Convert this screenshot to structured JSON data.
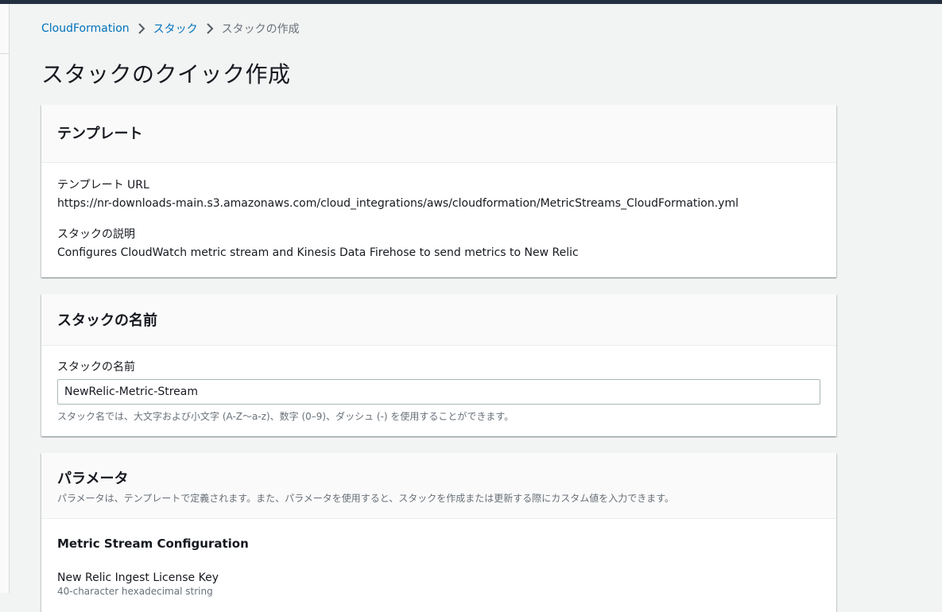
{
  "breadcrumb": {
    "items": [
      "CloudFormation",
      "スタック"
    ],
    "current": "スタックの作成"
  },
  "page": {
    "title": "スタックのクイック作成"
  },
  "template_panel": {
    "title": "テンプレート",
    "url_label": "テンプレート URL",
    "url_value": "https://nr-downloads-main.s3.amazonaws.com/cloud_integrations/aws/cloudformation/MetricStreams_CloudFormation.yml",
    "desc_label": "スタックの説明",
    "desc_value": "Configures CloudWatch metric stream and Kinesis Data Firehose to send metrics to New Relic"
  },
  "stackname_panel": {
    "title": "スタックの名前",
    "field_label": "スタックの名前",
    "field_value": "NewRelic-Metric-Stream",
    "hint": "スタック名では、大文字および小文字 (A-Z〜a-z)、数字 (0–9)、ダッシュ (-) を使用することができます。"
  },
  "params_panel": {
    "title": "パラメータ",
    "description": "パラメータは、テンプレートで定義されます。また、パラメータを使用すると、スタックを作成または更新する際にカスタム値を入力できます。",
    "section_title": "Metric Stream Configuration",
    "param_label": "New Relic Ingest License Key",
    "param_desc": "40-character hexadecimal string"
  },
  "icons": {
    "breadcrumb_separator": "chevron-right-icon"
  },
  "colors": {
    "link": "#0073bb",
    "topbar": "#232f3e",
    "background": "#f2f3f3"
  }
}
